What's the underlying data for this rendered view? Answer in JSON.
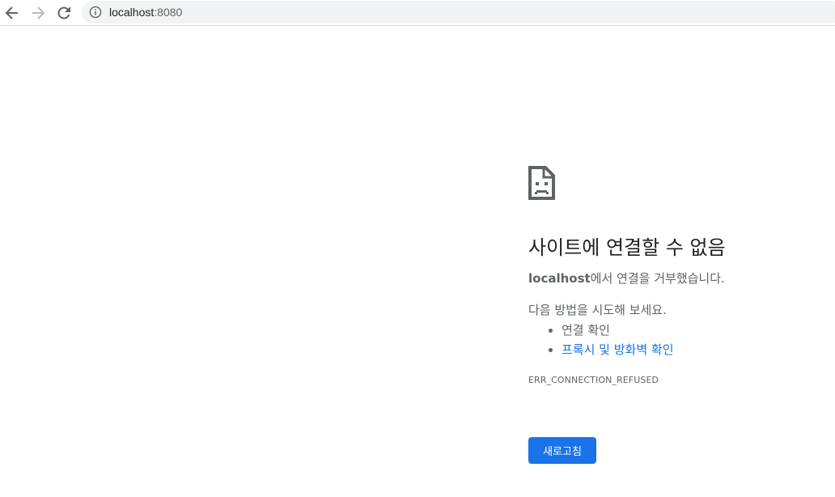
{
  "browser": {
    "url_host": "localhost",
    "url_port": ":8080",
    "icons": {
      "back": "back-arrow-icon",
      "forward": "forward-arrow-icon",
      "reload": "reload-icon",
      "site_info": "info-icon"
    }
  },
  "error_page": {
    "icon": "sad-document-icon",
    "title": "사이트에 연결할 수 없음",
    "host": "localhost",
    "description_suffix": "에서 연결을 거부했습니다.",
    "try_intro": "다음 방법을 시도해 보세요.",
    "suggestions": [
      {
        "label": "연결 확인",
        "link": false
      },
      {
        "label": "프록시 및 방화벽 확인",
        "link": true
      }
    ],
    "error_code": "ERR_CONNECTION_REFUSED",
    "reload_label": "새로고침"
  },
  "colors": {
    "accent": "#1a73e8",
    "text_primary": "#202124",
    "text_secondary": "#5f6368",
    "omnibox_bg": "#f1f3f4"
  }
}
